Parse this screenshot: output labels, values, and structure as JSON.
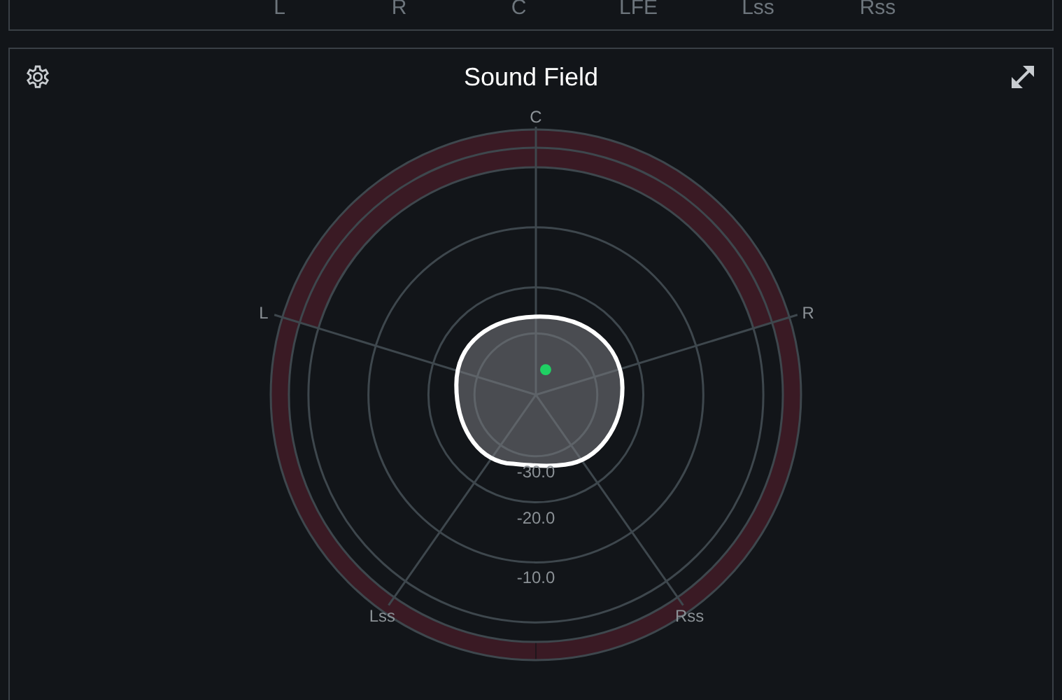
{
  "channel_strip": {
    "labels": [
      "L",
      "R",
      "C",
      "LFE",
      "Lss",
      "Rss"
    ]
  },
  "panel": {
    "title": "Sound Field"
  },
  "sound_field": {
    "speakers": [
      "C",
      "L",
      "R",
      "Lss",
      "Rss"
    ],
    "scale_labels": [
      "-30.0",
      "-20.0",
      "-10.0"
    ]
  }
}
